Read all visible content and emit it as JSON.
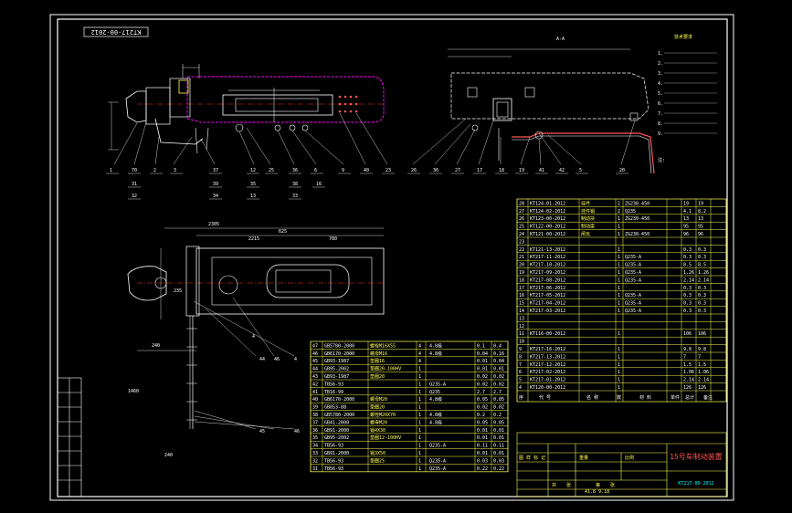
{
  "drawing": {
    "number_rotated": "KT217-00-2012",
    "number": "KT217-00-2012",
    "title": "15号车制动装置",
    "section_label": "A-A",
    "date": "41.8 9.18",
    "scale_cells": [
      "图 样 标 记",
      "重量",
      "比例"
    ],
    "sheet_cells": [
      "共",
      "张",
      "第",
      "张"
    ]
  },
  "notes": {
    "title": "技术要求",
    "lines": [
      "1.",
      "2.",
      "3.",
      "4.",
      "5.",
      "6.",
      "7.",
      "8.",
      "9."
    ]
  },
  "callouts_top_left": [
    "1",
    "70",
    "2",
    "3",
    "37",
    "12",
    "25",
    "36",
    "6",
    "9",
    "40",
    "23"
  ],
  "callouts_top_left_row2": [
    "31",
    "39",
    "35",
    "38",
    "16"
  ],
  "callouts_top_left_row3": [
    "32",
    "34",
    "13",
    "33"
  ],
  "callouts_top_right": [
    "26",
    "36",
    "27",
    "17",
    "18",
    "19",
    "41",
    "42",
    "5",
    "20"
  ],
  "callouts_bottom": [
    "4",
    "44",
    "46",
    "4",
    "45",
    "46"
  ],
  "dimensions": [
    "2305",
    "240",
    "625",
    "235",
    "2215",
    "780",
    "1460",
    "240"
  ],
  "right_table": {
    "rows": [
      {
        "n": "28",
        "code": "KT124-01-2012",
        "name": "挂件",
        "q": "2",
        "mat": "ZG230-450",
        "w1": "19",
        "w2": "19"
      },
      {
        "n": "27",
        "code": "KT124-02-2012",
        "name": "挂件销",
        "q": "2",
        "mat": "Q235",
        "w1": "4.1",
        "w2": "8.2"
      },
      {
        "n": "26",
        "code": "KT123-00-2012",
        "name": "制动块",
        "q": "1",
        "mat": "ZG230-450",
        "w1": "13",
        "w2": "13"
      },
      {
        "n": "25",
        "code": "KT122-00-2012",
        "name": "制动梁",
        "q": "1",
        "mat": "",
        "w1": "95",
        "w2": "95"
      },
      {
        "n": "24",
        "code": "KT121-00-2012",
        "name": "闸瓦",
        "q": "1",
        "mat": "ZG230-450",
        "w1": "96",
        "w2": "96"
      },
      {
        "n": "23",
        "code": "",
        "name": "",
        "q": "",
        "mat": "",
        "w1": "",
        "w2": ""
      },
      {
        "n": "22",
        "code": "KT121-13-2012",
        "name": "",
        "q": "1",
        "mat": "",
        "w1": "0.3",
        "w2": "0.3"
      },
      {
        "n": "21",
        "code": "KT217-11-2012",
        "name": "",
        "q": "1",
        "mat": "Q235-A",
        "w1": "0.3",
        "w2": "0.3"
      },
      {
        "n": "20",
        "code": "KT217-10-2012",
        "name": "",
        "q": "1",
        "mat": "Q235-A",
        "w1": "8.5",
        "w2": "8.5"
      },
      {
        "n": "19",
        "code": "KT217-09-2012",
        "name": "",
        "q": "1",
        "mat": "Q235-A",
        "w1": "1.26",
        "w2": "1.26"
      },
      {
        "n": "18",
        "code": "KT217-08-2012",
        "name": "",
        "q": "1",
        "mat": "Q235-A",
        "w1": "2.14",
        "w2": "2.14"
      },
      {
        "n": "17",
        "code": "KT217-06-2012",
        "name": "",
        "q": "1",
        "mat": "",
        "w1": "0.3",
        "w2": "0.3"
      },
      {
        "n": "16",
        "code": "KT217-05-2012",
        "name": "",
        "q": "1",
        "mat": "Q235-A",
        "w1": "0.3",
        "w2": "0.3"
      },
      {
        "n": "15",
        "code": "KT217-04-2012",
        "name": "",
        "q": "1",
        "mat": "Q235-A",
        "w1": "0.3",
        "w2": "0.3"
      },
      {
        "n": "14",
        "code": "KT217-03-2012",
        "name": "",
        "q": "1",
        "mat": "Q235-A",
        "w1": "0.3",
        "w2": "0.3"
      },
      {
        "n": "13",
        "code": "",
        "name": "",
        "q": "",
        "mat": "",
        "w1": "",
        "w2": ""
      },
      {
        "n": "12",
        "code": "",
        "name": "",
        "q": "",
        "mat": "",
        "w1": "",
        "w2": ""
      },
      {
        "n": "11",
        "code": "KT116-00-2012",
        "name": "",
        "q": "1",
        "mat": "",
        "w1": "106",
        "w2": "106"
      },
      {
        "n": "10",
        "code": "",
        "name": "",
        "q": "",
        "mat": "",
        "w1": "",
        "w2": ""
      },
      {
        "n": "9",
        "code": "KT217-16-2012",
        "name": "",
        "q": "1",
        "mat": "",
        "w1": "9.8",
        "w2": "9.8"
      },
      {
        "n": "8",
        "code": "KT217-13-2012",
        "name": "",
        "q": "1",
        "mat": "",
        "w1": "7",
        "w2": "7"
      },
      {
        "n": "7",
        "code": "KT217-12-2012",
        "name": "",
        "q": "1",
        "mat": "",
        "w1": "1.5",
        "w2": "1.5"
      },
      {
        "n": "6",
        "code": "KT217-02-2012",
        "name": "",
        "q": "1",
        "mat": "",
        "w1": "1.06",
        "w2": "1.06"
      },
      {
        "n": "5",
        "code": "KT217-01-2012",
        "name": "",
        "q": "1",
        "mat": "",
        "w1": "2.14",
        "w2": "2.14"
      },
      {
        "n": "4",
        "code": "KT120-00-2012",
        "name": "",
        "q": "1",
        "mat": "",
        "w1": "126",
        "w2": "126"
      }
    ],
    "header": [
      "序",
      "代 号",
      "名 称",
      "数",
      "材 料",
      "单件",
      "总计",
      "备注"
    ]
  },
  "left_table": {
    "rows": [
      {
        "n": "47",
        "code": "GB5780-2000",
        "name": "螺栓M16X55",
        "q": "4",
        "mat": "4.8级",
        "w1": "0.1",
        "w2": "0.4"
      },
      {
        "n": "46",
        "code": "GB6170-2000",
        "name": "螺母M16",
        "q": "4",
        "mat": "4.8级",
        "w1": "0.04",
        "w2": "0.16"
      },
      {
        "n": "45",
        "code": "GB93-1987",
        "name": "垫圈16",
        "q": "4",
        "mat": "",
        "w1": "0.01",
        "w2": "0.04"
      },
      {
        "n": "44",
        "code": "GB95-2002",
        "name": "垫圈20-100HV",
        "q": "1",
        "mat": "",
        "w1": "0.01",
        "w2": "0.01"
      },
      {
        "n": "43",
        "code": "GB93-1987",
        "name": "垫圈20",
        "q": "1",
        "mat": "",
        "w1": "0.02",
        "w2": "0.02"
      },
      {
        "n": "42",
        "code": "TB56-93",
        "name": "",
        "q": "1",
        "mat": "Q235-A",
        "w1": "0.02",
        "w2": "0.02"
      },
      {
        "n": "41",
        "code": "TB16-99",
        "name": "",
        "q": "1",
        "mat": "Q235",
        "w1": "2.7",
        "w2": "2.7"
      },
      {
        "n": "40",
        "code": "GB6170-2000",
        "name": "螺母M20",
        "q": "1",
        "mat": "4.8级",
        "w1": "0.05",
        "w2": "0.05"
      },
      {
        "n": "39",
        "code": "GB853-88",
        "name": "垫圈20",
        "q": "1",
        "mat": "",
        "w1": "0.02",
        "w2": "0.02"
      },
      {
        "n": "38",
        "code": "GB5780-2000",
        "name": "螺栓M20X70",
        "q": "1",
        "mat": "4.8级",
        "w1": "0.2",
        "w2": "0.2"
      },
      {
        "n": "37",
        "code": "GB41-2000",
        "name": "螺母M20",
        "q": "1",
        "mat": "4.8级",
        "w1": "0.05",
        "w2": "0.05"
      },
      {
        "n": "36",
        "code": "GB91-2000",
        "name": "销4X30",
        "q": "1",
        "mat": "",
        "w1": "0.01",
        "w2": "0.01"
      },
      {
        "n": "35",
        "code": "GB95-2002",
        "name": "垫圈12-100HV",
        "q": "1",
        "mat": "",
        "w1": "0.01",
        "w2": "0.01"
      },
      {
        "n": "34",
        "code": "TB56-93",
        "name": "",
        "q": "1",
        "mat": "Q235-A",
        "w1": "0.11",
        "w2": "0.11"
      },
      {
        "n": "33",
        "code": "GB91-2000",
        "name": "销3X50",
        "q": "1",
        "mat": "",
        "w1": "0.01",
        "w2": "0.01"
      },
      {
        "n": "32",
        "code": "TB56-93",
        "name": "垫圈25",
        "q": "1",
        "mat": "Q235-A",
        "w1": "0.03",
        "w2": "0.03"
      },
      {
        "n": "31",
        "code": "TB56-93",
        "name": "",
        "q": "1",
        "mat": "Q235-A",
        "w1": "0.22",
        "w2": "0.22"
      }
    ]
  },
  "side_stamp": [
    "",
    "",
    "",
    "",
    "",
    "",
    "",
    ""
  ],
  "colors": {
    "background": "#000000",
    "frame": "#ffffff",
    "table_lines": "#ffff55",
    "machine": "#ffffff",
    "highlight": "#ff00ff",
    "centerline": "#ff3333",
    "text_cyan": "#00ffff"
  }
}
